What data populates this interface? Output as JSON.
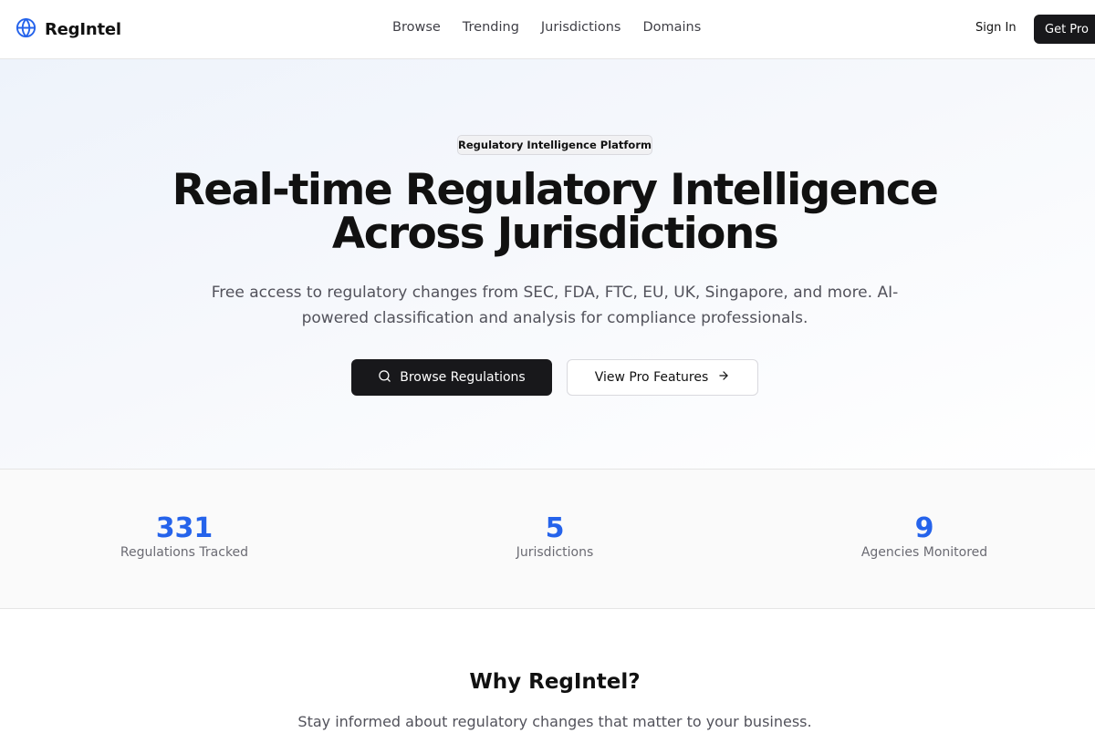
{
  "header": {
    "brand": "RegIntel",
    "nav": [
      "Browse",
      "Trending",
      "Jurisdictions",
      "Domains"
    ],
    "sign_in": "Sign In",
    "get_pro": "Get Pro"
  },
  "hero": {
    "badge": "Regulatory Intelligence Platform",
    "title_line1": "Real-time Regulatory Intelligence",
    "title_line2": "Across Jurisdictions",
    "subtitle": "Free access to regulatory changes from SEC, FDA, FTC, EU, UK, Singapore, and more. AI-powered classification and analysis for compliance professionals.",
    "primary_button": "Browse Regulations",
    "secondary_button": "View Pro Features"
  },
  "stats": [
    {
      "value": "331",
      "label": "Regulations Tracked"
    },
    {
      "value": "5",
      "label": "Jurisdictions"
    },
    {
      "value": "9",
      "label": "Agencies Monitored"
    }
  ],
  "why": {
    "title": "Why RegIntel?",
    "subtitle": "Stay informed about regulatory changes that matter to your business."
  },
  "colors": {
    "accent": "#2563eb",
    "dark": "#18181b"
  },
  "icons": {
    "brand": "globe-icon",
    "primary_button": "search-icon",
    "secondary_button": "arrow-right-icon"
  }
}
